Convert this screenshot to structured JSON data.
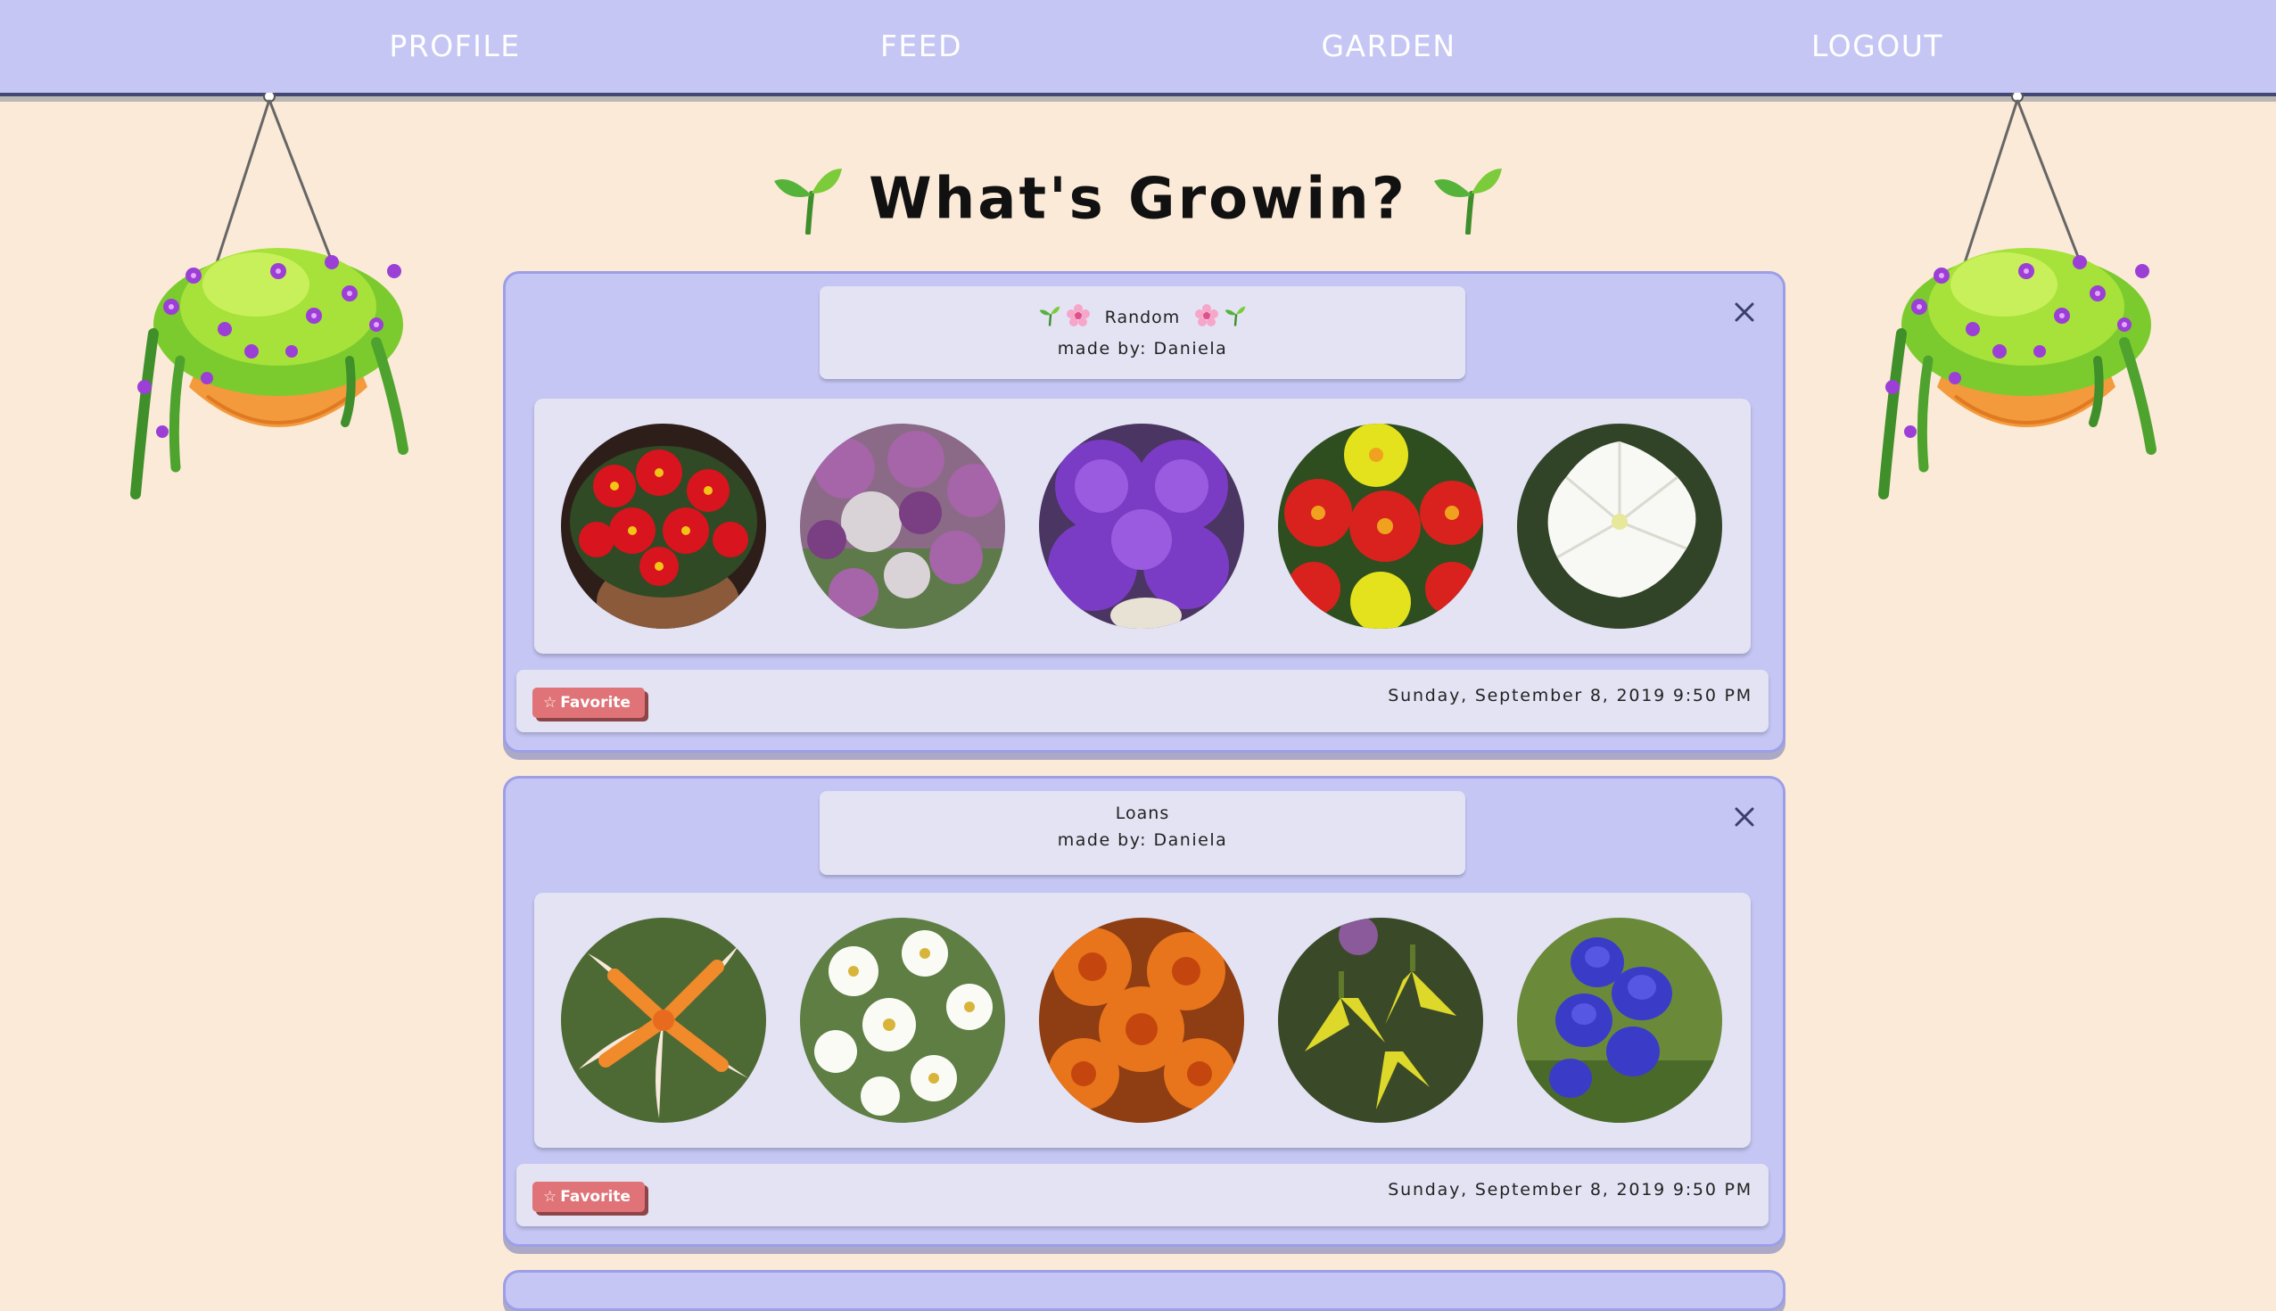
{
  "nav": {
    "items": [
      {
        "label": "PROFILE"
      },
      {
        "label": "FEED"
      },
      {
        "label": "GARDEN"
      },
      {
        "label": "LOGOUT"
      }
    ]
  },
  "page": {
    "title": "What's Growin?",
    "title_icon": "sprout-icon"
  },
  "posts": [
    {
      "name": "Random",
      "name_icons": [
        "sprout-icon",
        "pink-flower-icon"
      ],
      "author": "made by: Daniela",
      "flowers": [
        "red begonia",
        "purple allium",
        "purple carnation",
        "red and yellow zinnia",
        "white petunia"
      ],
      "favorite_label": "Favorite",
      "date": "Sunday, September 8, 2019 9:50 PM"
    },
    {
      "name": "Loans",
      "name_icons": [],
      "author": "made by: Daniela",
      "flowers": [
        "orange lily",
        "white daffodil",
        "orange marigold",
        "yellow fritillaria",
        "blue monkshood"
      ],
      "favorite_label": "Favorite",
      "date": "Sunday, September 8, 2019 9:50 PM"
    }
  ],
  "colors": {
    "background": "#FBEAD7",
    "nav": "#C5C6F4",
    "card": "#C5C6F4",
    "panel": "#E3E3F4",
    "favorite": "#E07377"
  }
}
